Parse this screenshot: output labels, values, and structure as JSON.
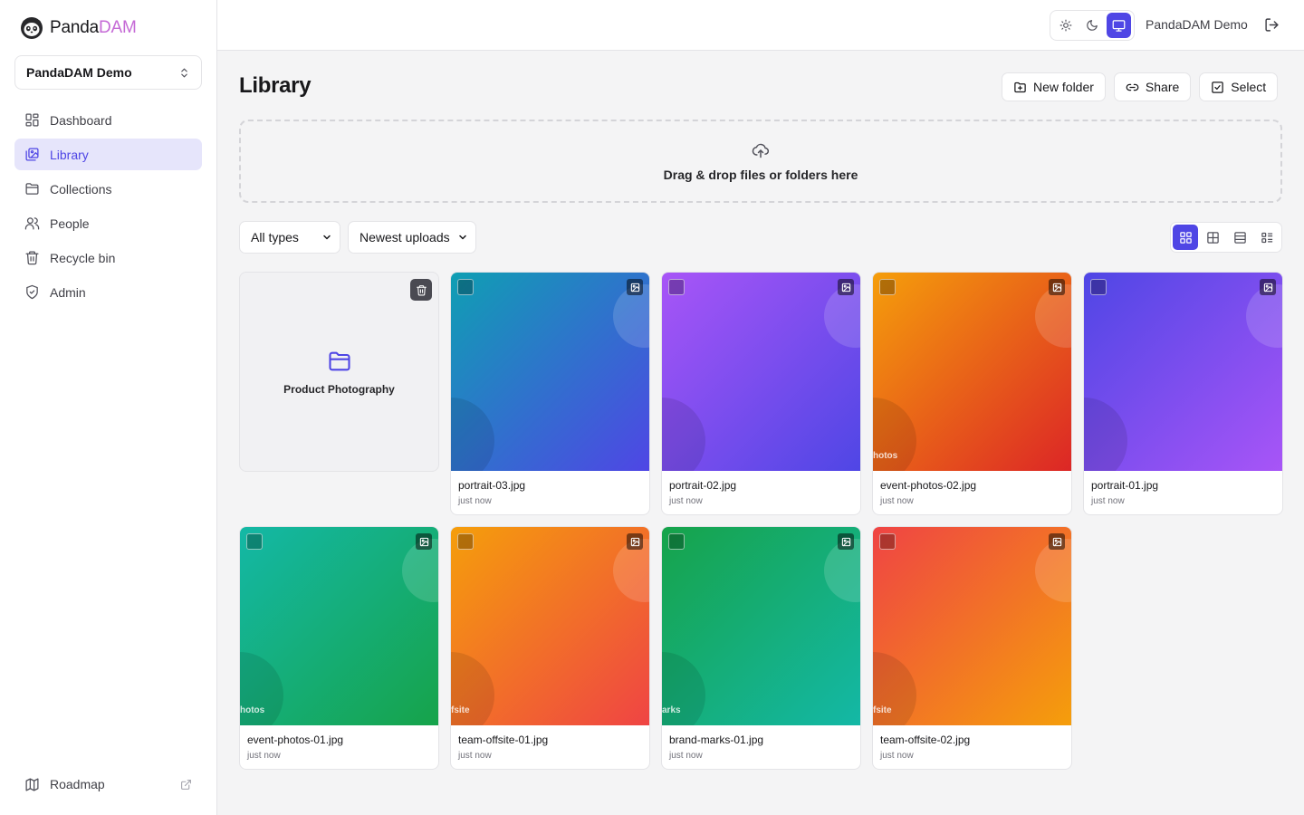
{
  "brand": {
    "name_part1": "Panda",
    "name_part2": "DAM"
  },
  "workspace": {
    "label": "PandaDAM Demo"
  },
  "sidebar": {
    "items": [
      {
        "label": "Dashboard",
        "icon": "dashboard-icon"
      },
      {
        "label": "Library",
        "icon": "library-icon",
        "active": true
      },
      {
        "label": "Collections",
        "icon": "folder-icon"
      },
      {
        "label": "People",
        "icon": "people-icon"
      },
      {
        "label": "Recycle bin",
        "icon": "trash-icon"
      },
      {
        "label": "Admin",
        "icon": "shield-icon"
      }
    ],
    "footer": {
      "label": "Roadmap",
      "icon": "map-icon"
    }
  },
  "topbar": {
    "theme_options": [
      "light",
      "dark",
      "system"
    ],
    "theme_selected": "system",
    "user": "PandaDAM Demo"
  },
  "page": {
    "title": "Library"
  },
  "actions": {
    "new_folder": "New folder",
    "share": "Share",
    "select": "Select"
  },
  "dropzone": {
    "text": "Drag & drop files or folders here"
  },
  "filters": {
    "type": {
      "selected": "All types"
    },
    "sort": {
      "selected": "Newest uploads"
    }
  },
  "view_modes": {
    "options": [
      "grid-large",
      "grid-small",
      "list",
      "details"
    ],
    "selected": "grid-large"
  },
  "accent_color": "#4f46e5",
  "folders": [
    {
      "name": "Product Photography"
    }
  ],
  "assets": [
    {
      "name": "portrait-03.jpg",
      "time": "just now",
      "thumb_label": "",
      "grad": [
        "#0f9fb3",
        "#4f46e5"
      ]
    },
    {
      "name": "portrait-02.jpg",
      "time": "just now",
      "thumb_label": "",
      "grad": [
        "#a855f7",
        "#4f46e5"
      ]
    },
    {
      "name": "event-photos-02.jpg",
      "time": "just now",
      "thumb_label": "hotos",
      "grad": [
        "#f59e0b",
        "#dc2626"
      ]
    },
    {
      "name": "portrait-01.jpg",
      "time": "just now",
      "thumb_label": "",
      "grad": [
        "#4f46e5",
        "#a855f7"
      ]
    },
    {
      "name": "event-photos-01.jpg",
      "time": "just now",
      "thumb_label": "hotos",
      "grad": [
        "#14b8a6",
        "#16a34a"
      ]
    },
    {
      "name": "team-offsite-01.jpg",
      "time": "just now",
      "thumb_label": "fsite",
      "grad": [
        "#f59e0b",
        "#ef4444"
      ]
    },
    {
      "name": "brand-marks-01.jpg",
      "time": "just now",
      "thumb_label": "arks",
      "grad": [
        "#16a34a",
        "#14b8a6"
      ]
    },
    {
      "name": "team-offsite-02.jpg",
      "time": "just now",
      "thumb_label": "fsite",
      "grad": [
        "#ef4444",
        "#f59e0b"
      ]
    }
  ]
}
